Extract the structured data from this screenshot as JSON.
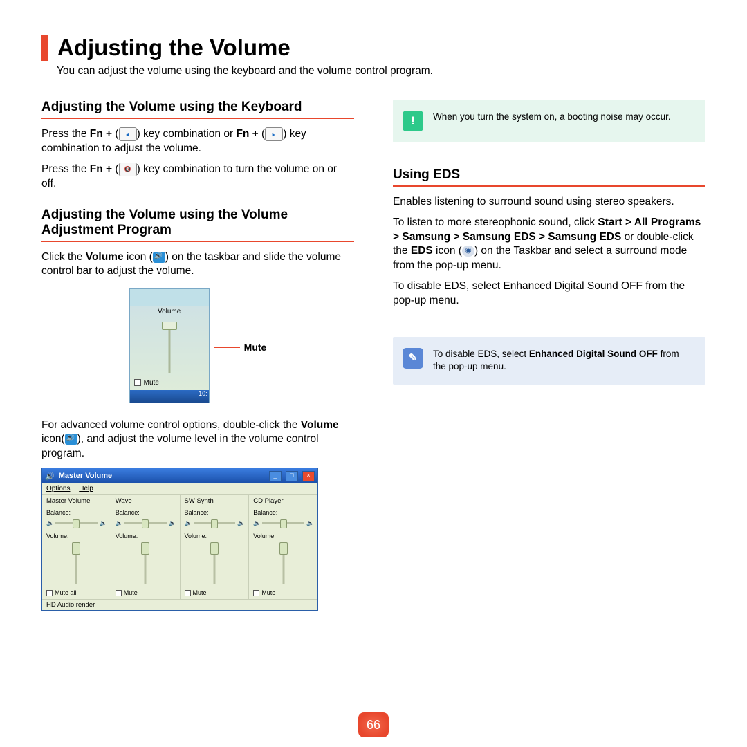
{
  "page": {
    "title": "Adjusting the Volume",
    "subtitle": "You can adjust the volume using the keyboard and the volume control program.",
    "number": "66"
  },
  "left": {
    "h1": "Adjusting the Volume using the Keyboard",
    "p1a": "Press the ",
    "p1b": "Fn + ",
    "p1c": " key combination or ",
    "p1d": "Fn + ",
    "p1e": " key combination to adjust the volume.",
    "p2a": "Press the ",
    "p2b": "Fn + ",
    "p2c": " key combination to turn the volume on or off.",
    "h2": "Adjusting the Volume using the Volume Adjustment Program",
    "p3a": "Click the ",
    "p3b": "Volume",
    "p3c": " icon (",
    "p3d": ") on the taskbar and slide the volume control bar to adjust the volume.",
    "popup": {
      "label": "Volume",
      "mute": "Mute",
      "time": "10:"
    },
    "callout": "Mute",
    "p4a": "For advanced volume control options, double-click the ",
    "p4b": "Volume",
    "p4c": " icon(",
    "p4d": "), and adjust the volume level in the volume control program.",
    "mv": {
      "title": "Master Volume",
      "menu_options": "Options",
      "menu_help": "Help",
      "channels": [
        {
          "name": "Master Volume",
          "mute": "Mute all"
        },
        {
          "name": "Wave",
          "mute": "Mute"
        },
        {
          "name": "SW Synth",
          "mute": "Mute"
        },
        {
          "name": "CD Player",
          "mute": "Mute"
        }
      ],
      "balance": "Balance:",
      "volume": "Volume:",
      "footer": "HD Audio render"
    }
  },
  "right": {
    "info1": "When you turn the system on, a booting noise may occur.",
    "h1": "Using EDS",
    "p1": "Enables listening to surround sound using stereo speakers.",
    "p2a": "To listen to more stereophonic sound, click ",
    "p2b": "Start > All Programs > Samsung > Samsung EDS > Samsung EDS",
    "p2c": " or double-click the ",
    "p2d": "EDS",
    "p2e": " icon (",
    "p2f": ") on the Taskbar and select  a surround mode from the pop-up menu.",
    "p3": "To disable EDS, select Enhanced Digital Sound OFF from the pop-up menu.",
    "info2a": "To disable EDS, select ",
    "info2b": "Enhanced Digital Sound OFF",
    "info2c": " from the pop-up menu."
  }
}
